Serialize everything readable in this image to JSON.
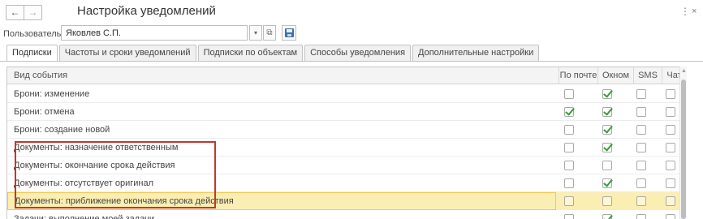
{
  "title": "Настройка уведомлений",
  "nav": {
    "back_glyph": "←",
    "forward_glyph": "→"
  },
  "window": {
    "more_glyph": "⋮",
    "close_glyph": "×"
  },
  "user": {
    "label": "Пользователь:",
    "value": "Яковлев С.П.",
    "dropdown_glyph": "▾",
    "open_glyph": "⧉"
  },
  "tabs": [
    {
      "label": "Подписки",
      "active": true
    },
    {
      "label": "Частоты и сроки уведомлений",
      "active": false
    },
    {
      "label": "Подписки по объектам",
      "active": false
    },
    {
      "label": "Способы уведомления",
      "active": false
    },
    {
      "label": "Дополнительные настройки",
      "active": false
    }
  ],
  "table": {
    "columns": {
      "event": "Вид события",
      "by_mail": "По почте",
      "by_window": "Окном",
      "sms": "SMS",
      "chat": "Чат"
    },
    "rows": [
      {
        "event": "Брони: изменение",
        "by_mail": false,
        "by_window": true,
        "sms": false,
        "chat": false,
        "selected": false
      },
      {
        "event": "Брони: отмена",
        "by_mail": true,
        "by_window": true,
        "sms": false,
        "chat": false,
        "selected": false
      },
      {
        "event": "Брони: создание новой",
        "by_mail": false,
        "by_window": true,
        "sms": false,
        "chat": false,
        "selected": false
      },
      {
        "event": "Документы: назначение ответственным",
        "by_mail": false,
        "by_window": true,
        "sms": false,
        "chat": false,
        "selected": false
      },
      {
        "event": "Документы: окончание срока действия",
        "by_mail": false,
        "by_window": false,
        "sms": false,
        "chat": false,
        "selected": false
      },
      {
        "event": "Документы: отсутствует оригинал",
        "by_mail": false,
        "by_window": true,
        "sms": false,
        "chat": false,
        "selected": false
      },
      {
        "event": "Документы: приближение окончания срока действия",
        "by_mail": false,
        "by_window": false,
        "sms": false,
        "chat": false,
        "selected": true
      },
      {
        "event": "Задачи: выполнение моей задачи",
        "by_mail": false,
        "by_window": true,
        "sms": false,
        "chat": false,
        "selected": false
      }
    ]
  },
  "colors": {
    "selected_row": "#fbeeb2",
    "highlight_border": "#c0392b",
    "check": "#3a9a3a"
  }
}
